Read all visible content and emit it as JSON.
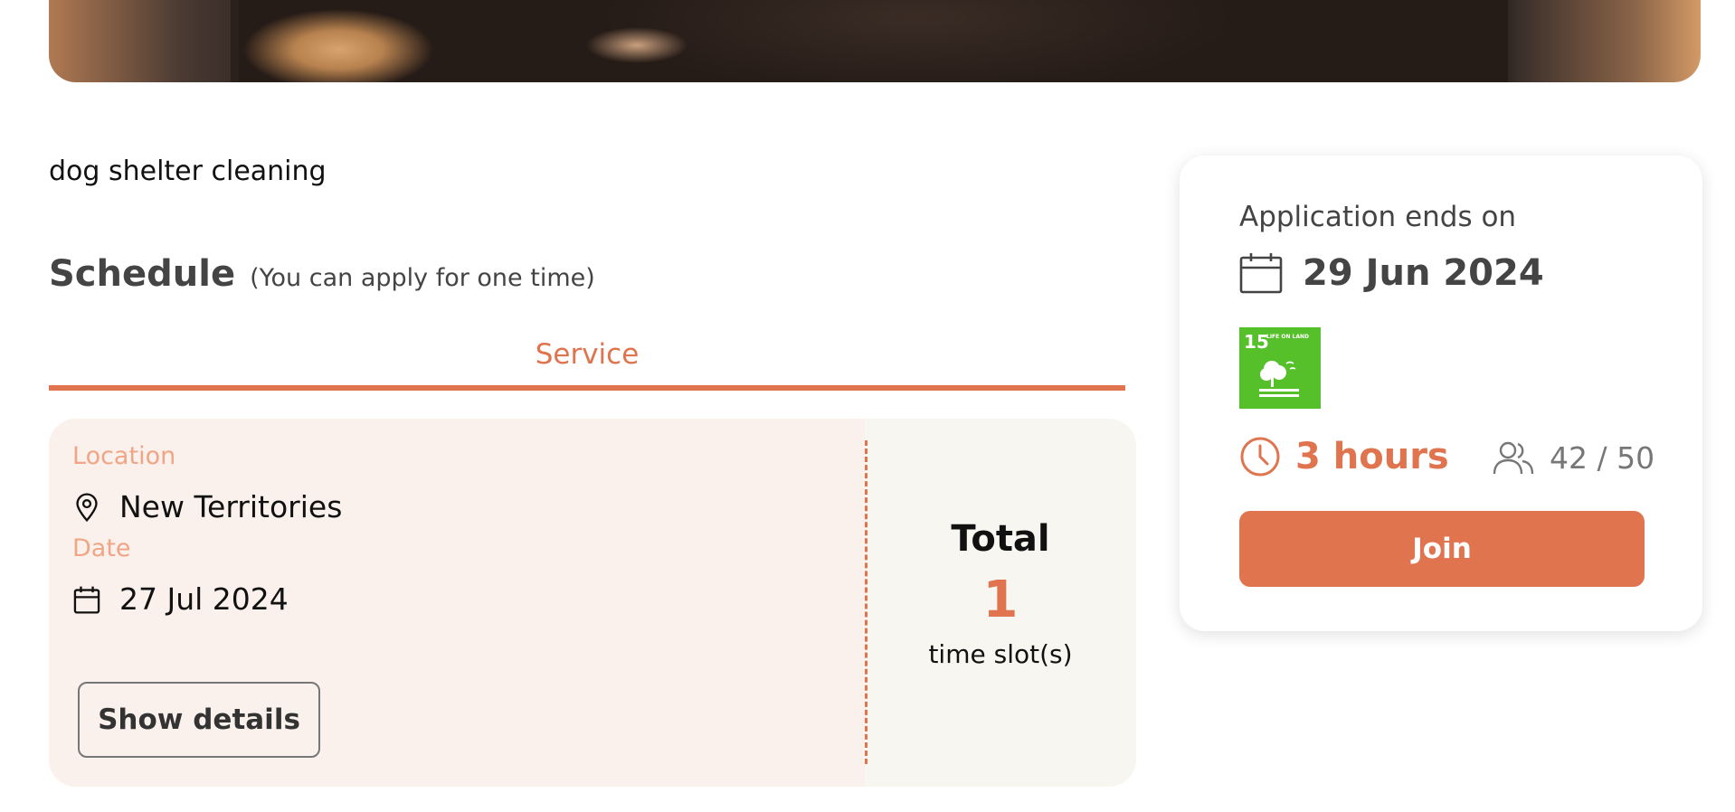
{
  "description": "dog shelter cleaning",
  "schedule": {
    "title": "Schedule",
    "note": "(You can apply for one time)",
    "tab_label": "Service"
  },
  "slot": {
    "location_label": "Location",
    "location_value": "New Territories",
    "date_label": "Date",
    "date_value": "27 Jul 2024",
    "details_button": "Show details"
  },
  "total": {
    "label": "Total",
    "count": "1",
    "unit": "time slot(s)"
  },
  "sidebar": {
    "application_label": "Application ends on",
    "application_date": "29 Jun 2024",
    "sdg_badge": {
      "number": "15",
      "text": "LIFE ON LAND",
      "color": "#56c02b"
    },
    "duration": "3 hours",
    "participants": "42 / 50",
    "join_button": "Join"
  },
  "colors": {
    "accent": "#e0744f",
    "card_bg": "#fbf1ec",
    "label_color": "#f0a585"
  },
  "icons": [
    "location-pin-icon",
    "calendar-icon",
    "clock-icon",
    "people-icon"
  ]
}
